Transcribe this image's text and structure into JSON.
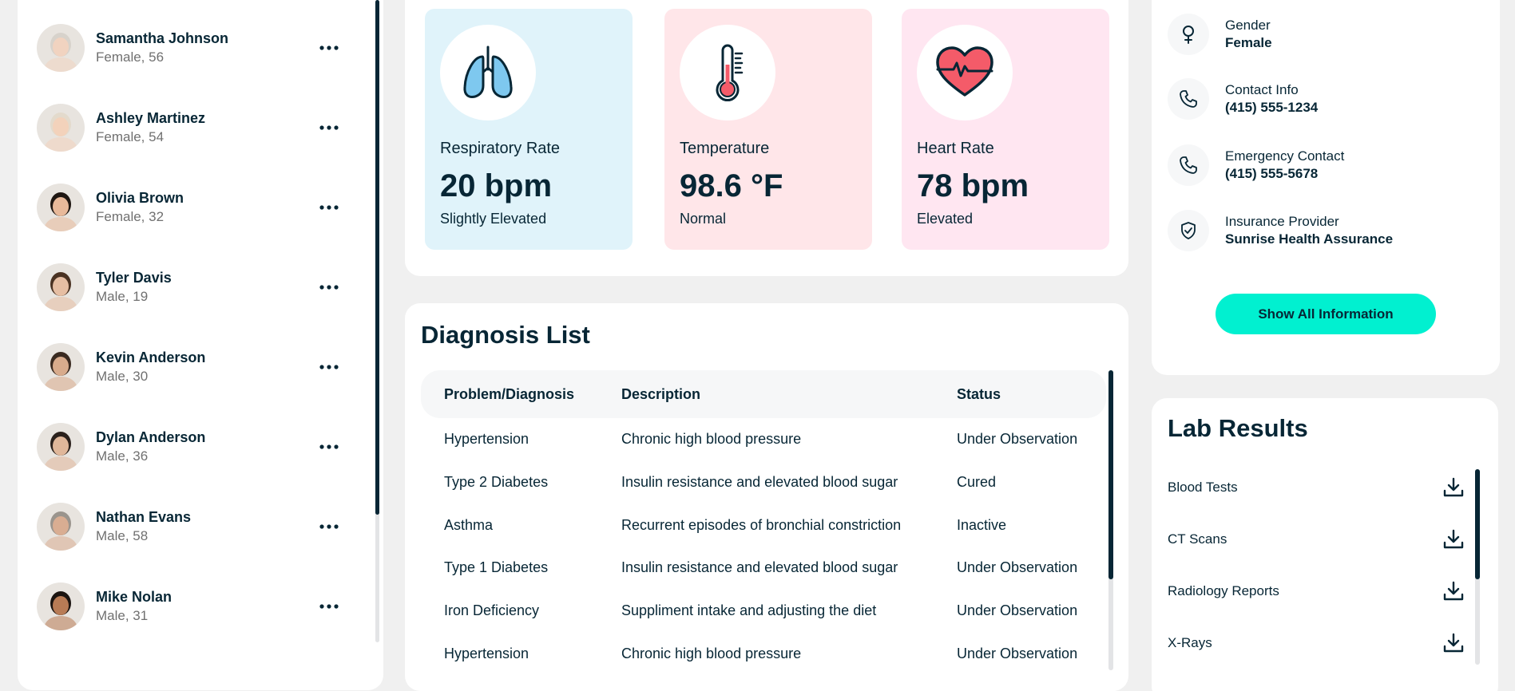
{
  "patients": [
    {
      "name": "Samantha Johnson",
      "meta": "Female, 56",
      "skin": "#f1d3c0",
      "hair": "#d7d2cb"
    },
    {
      "name": "Ashley Martinez",
      "meta": "Female, 54",
      "skin": "#f3d2bb",
      "hair": "#e3dacc"
    },
    {
      "name": "Olivia Brown",
      "meta": "Female, 32",
      "skin": "#e8b99a",
      "hair": "#1f1712"
    },
    {
      "name": "Tyler Davis",
      "meta": "Male, 19",
      "skin": "#e6bea3",
      "hair": "#4a3222"
    },
    {
      "name": "Kevin Anderson",
      "meta": "Male, 30",
      "skin": "#d8ab8c",
      "hair": "#3a2a20"
    },
    {
      "name": "Dylan Anderson",
      "meta": "Male, 36",
      "skin": "#e0b79a",
      "hair": "#2b211c"
    },
    {
      "name": "Nathan Evans",
      "meta": "Male, 58",
      "skin": "#d9ad92",
      "hair": "#9a948d"
    },
    {
      "name": "Mike Nolan",
      "meta": "Male, 31",
      "skin": "#b87b55",
      "hair": "#1b1410"
    }
  ],
  "vitals": [
    {
      "label": "Respiratory Rate",
      "value": "20 bpm",
      "status": "Slightly Elevated",
      "bg": "#e0f3fa",
      "icon": "lungs-icon"
    },
    {
      "label": "Temperature",
      "value": "98.6 °F",
      "status": "Normal",
      "bg": "#ffe6e9",
      "icon": "thermometer-icon"
    },
    {
      "label": "Heart Rate",
      "value": "78 bpm",
      "status": "Elevated",
      "bg": "#ffe6f1",
      "icon": "heart-icon"
    }
  ],
  "diagnosis": {
    "title": "Diagnosis List",
    "headers": [
      "Problem/Diagnosis",
      "Description",
      "Status"
    ],
    "rows": [
      [
        "Hypertension",
        "Chronic high blood pressure",
        "Under Observation"
      ],
      [
        "Type 2 Diabetes",
        "Insulin resistance and elevated blood sugar",
        "Cured"
      ],
      [
        "Asthma",
        "Recurrent episodes of bronchial constriction",
        "Inactive"
      ],
      [
        "Type 1 Diabetes",
        "Insulin resistance and elevated blood sugar",
        "Under Observation"
      ],
      [
        "Iron Deficiency",
        "Suppliment intake and adjusting the diet",
        "Under Observation"
      ],
      [
        "Hypertension",
        "Chronic high blood pressure",
        "Under Observation"
      ]
    ]
  },
  "info": {
    "items": [
      {
        "label": "Gender",
        "value": "Female",
        "icon": "female-icon"
      },
      {
        "label": "Contact Info",
        "value": "(415) 555-1234",
        "icon": "phone-icon"
      },
      {
        "label": "Emergency Contact",
        "value": "(415) 555-5678",
        "icon": "phone-icon"
      },
      {
        "label": "Insurance Provider",
        "value": "Sunrise Health Assurance",
        "icon": "shield-check-icon"
      }
    ],
    "button": "Show All Information"
  },
  "lab": {
    "title": "Lab Results",
    "items": [
      "Blood Tests",
      "CT Scans",
      "Radiology Reports",
      "X-Rays"
    ]
  },
  "colors": {
    "navy": "#072635",
    "accent": "#01f0d0",
    "background": "#f0f0f0"
  }
}
